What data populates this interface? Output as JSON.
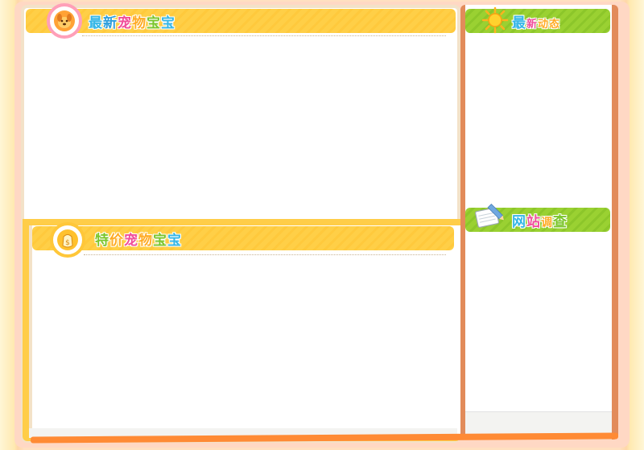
{
  "sections": {
    "new_pets": {
      "title": [
        "最",
        "新",
        "宠",
        "物",
        "宝",
        "宝"
      ]
    },
    "special_pets": {
      "title": [
        "特",
        "价",
        "宠",
        "物",
        "宝",
        "宝"
      ]
    },
    "latest_news": {
      "title": [
        "最",
        "新",
        "动",
        "态"
      ]
    },
    "site_survey": {
      "title": [
        "网",
        "站",
        "调",
        "查"
      ]
    }
  },
  "colors": {
    "title_yellow": "#ffcf47",
    "title_green": "#9ad132",
    "accent_orange": "#ff8a34",
    "side_border": "#e28b5a"
  },
  "icons": {
    "new_pets": "dog-icon",
    "special_pets": "money-bag-icon",
    "latest_news": "sun-icon",
    "site_survey": "notepad-pencil-icon"
  }
}
